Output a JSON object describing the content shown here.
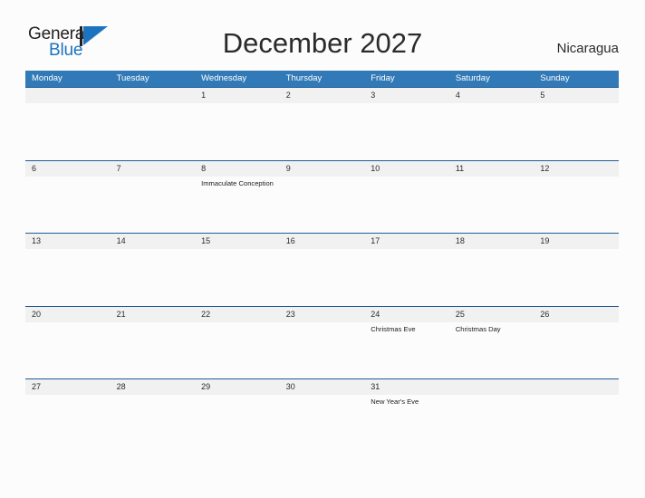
{
  "brand": {
    "word_one": "General",
    "word_two": "Blue",
    "mark_icon": "flag-triangle-icon",
    "accent_color": "#1e73be"
  },
  "header": {
    "title": "December 2027",
    "country": "Nicaragua"
  },
  "theme": {
    "header_blue": "#3279b7",
    "row_band_gray": "#f1f1f1",
    "row_rule_blue": "#1f5c96",
    "page_background": "#fcfcfc",
    "text_color": "#2b2b2b"
  },
  "calendar": {
    "month": "December",
    "year": "2027",
    "day_headers": [
      "Monday",
      "Tuesday",
      "Wednesday",
      "Thursday",
      "Friday",
      "Saturday",
      "Sunday"
    ],
    "weeks": [
      {
        "days": [
          {
            "num": "",
            "event": ""
          },
          {
            "num": "",
            "event": ""
          },
          {
            "num": "1",
            "event": ""
          },
          {
            "num": "2",
            "event": ""
          },
          {
            "num": "3",
            "event": ""
          },
          {
            "num": "4",
            "event": ""
          },
          {
            "num": "5",
            "event": ""
          }
        ]
      },
      {
        "days": [
          {
            "num": "6",
            "event": ""
          },
          {
            "num": "7",
            "event": ""
          },
          {
            "num": "8",
            "event": "Immaculate Conception"
          },
          {
            "num": "9",
            "event": ""
          },
          {
            "num": "10",
            "event": ""
          },
          {
            "num": "11",
            "event": ""
          },
          {
            "num": "12",
            "event": ""
          }
        ]
      },
      {
        "days": [
          {
            "num": "13",
            "event": ""
          },
          {
            "num": "14",
            "event": ""
          },
          {
            "num": "15",
            "event": ""
          },
          {
            "num": "16",
            "event": ""
          },
          {
            "num": "17",
            "event": ""
          },
          {
            "num": "18",
            "event": ""
          },
          {
            "num": "19",
            "event": ""
          }
        ]
      },
      {
        "days": [
          {
            "num": "20",
            "event": ""
          },
          {
            "num": "21",
            "event": ""
          },
          {
            "num": "22",
            "event": ""
          },
          {
            "num": "23",
            "event": ""
          },
          {
            "num": "24",
            "event": "Christmas Eve"
          },
          {
            "num": "25",
            "event": "Christmas Day"
          },
          {
            "num": "26",
            "event": ""
          }
        ]
      },
      {
        "days": [
          {
            "num": "27",
            "event": ""
          },
          {
            "num": "28",
            "event": ""
          },
          {
            "num": "29",
            "event": ""
          },
          {
            "num": "30",
            "event": ""
          },
          {
            "num": "31",
            "event": "New Year's Eve"
          },
          {
            "num": "",
            "event": ""
          },
          {
            "num": "",
            "event": ""
          }
        ]
      }
    ]
  }
}
